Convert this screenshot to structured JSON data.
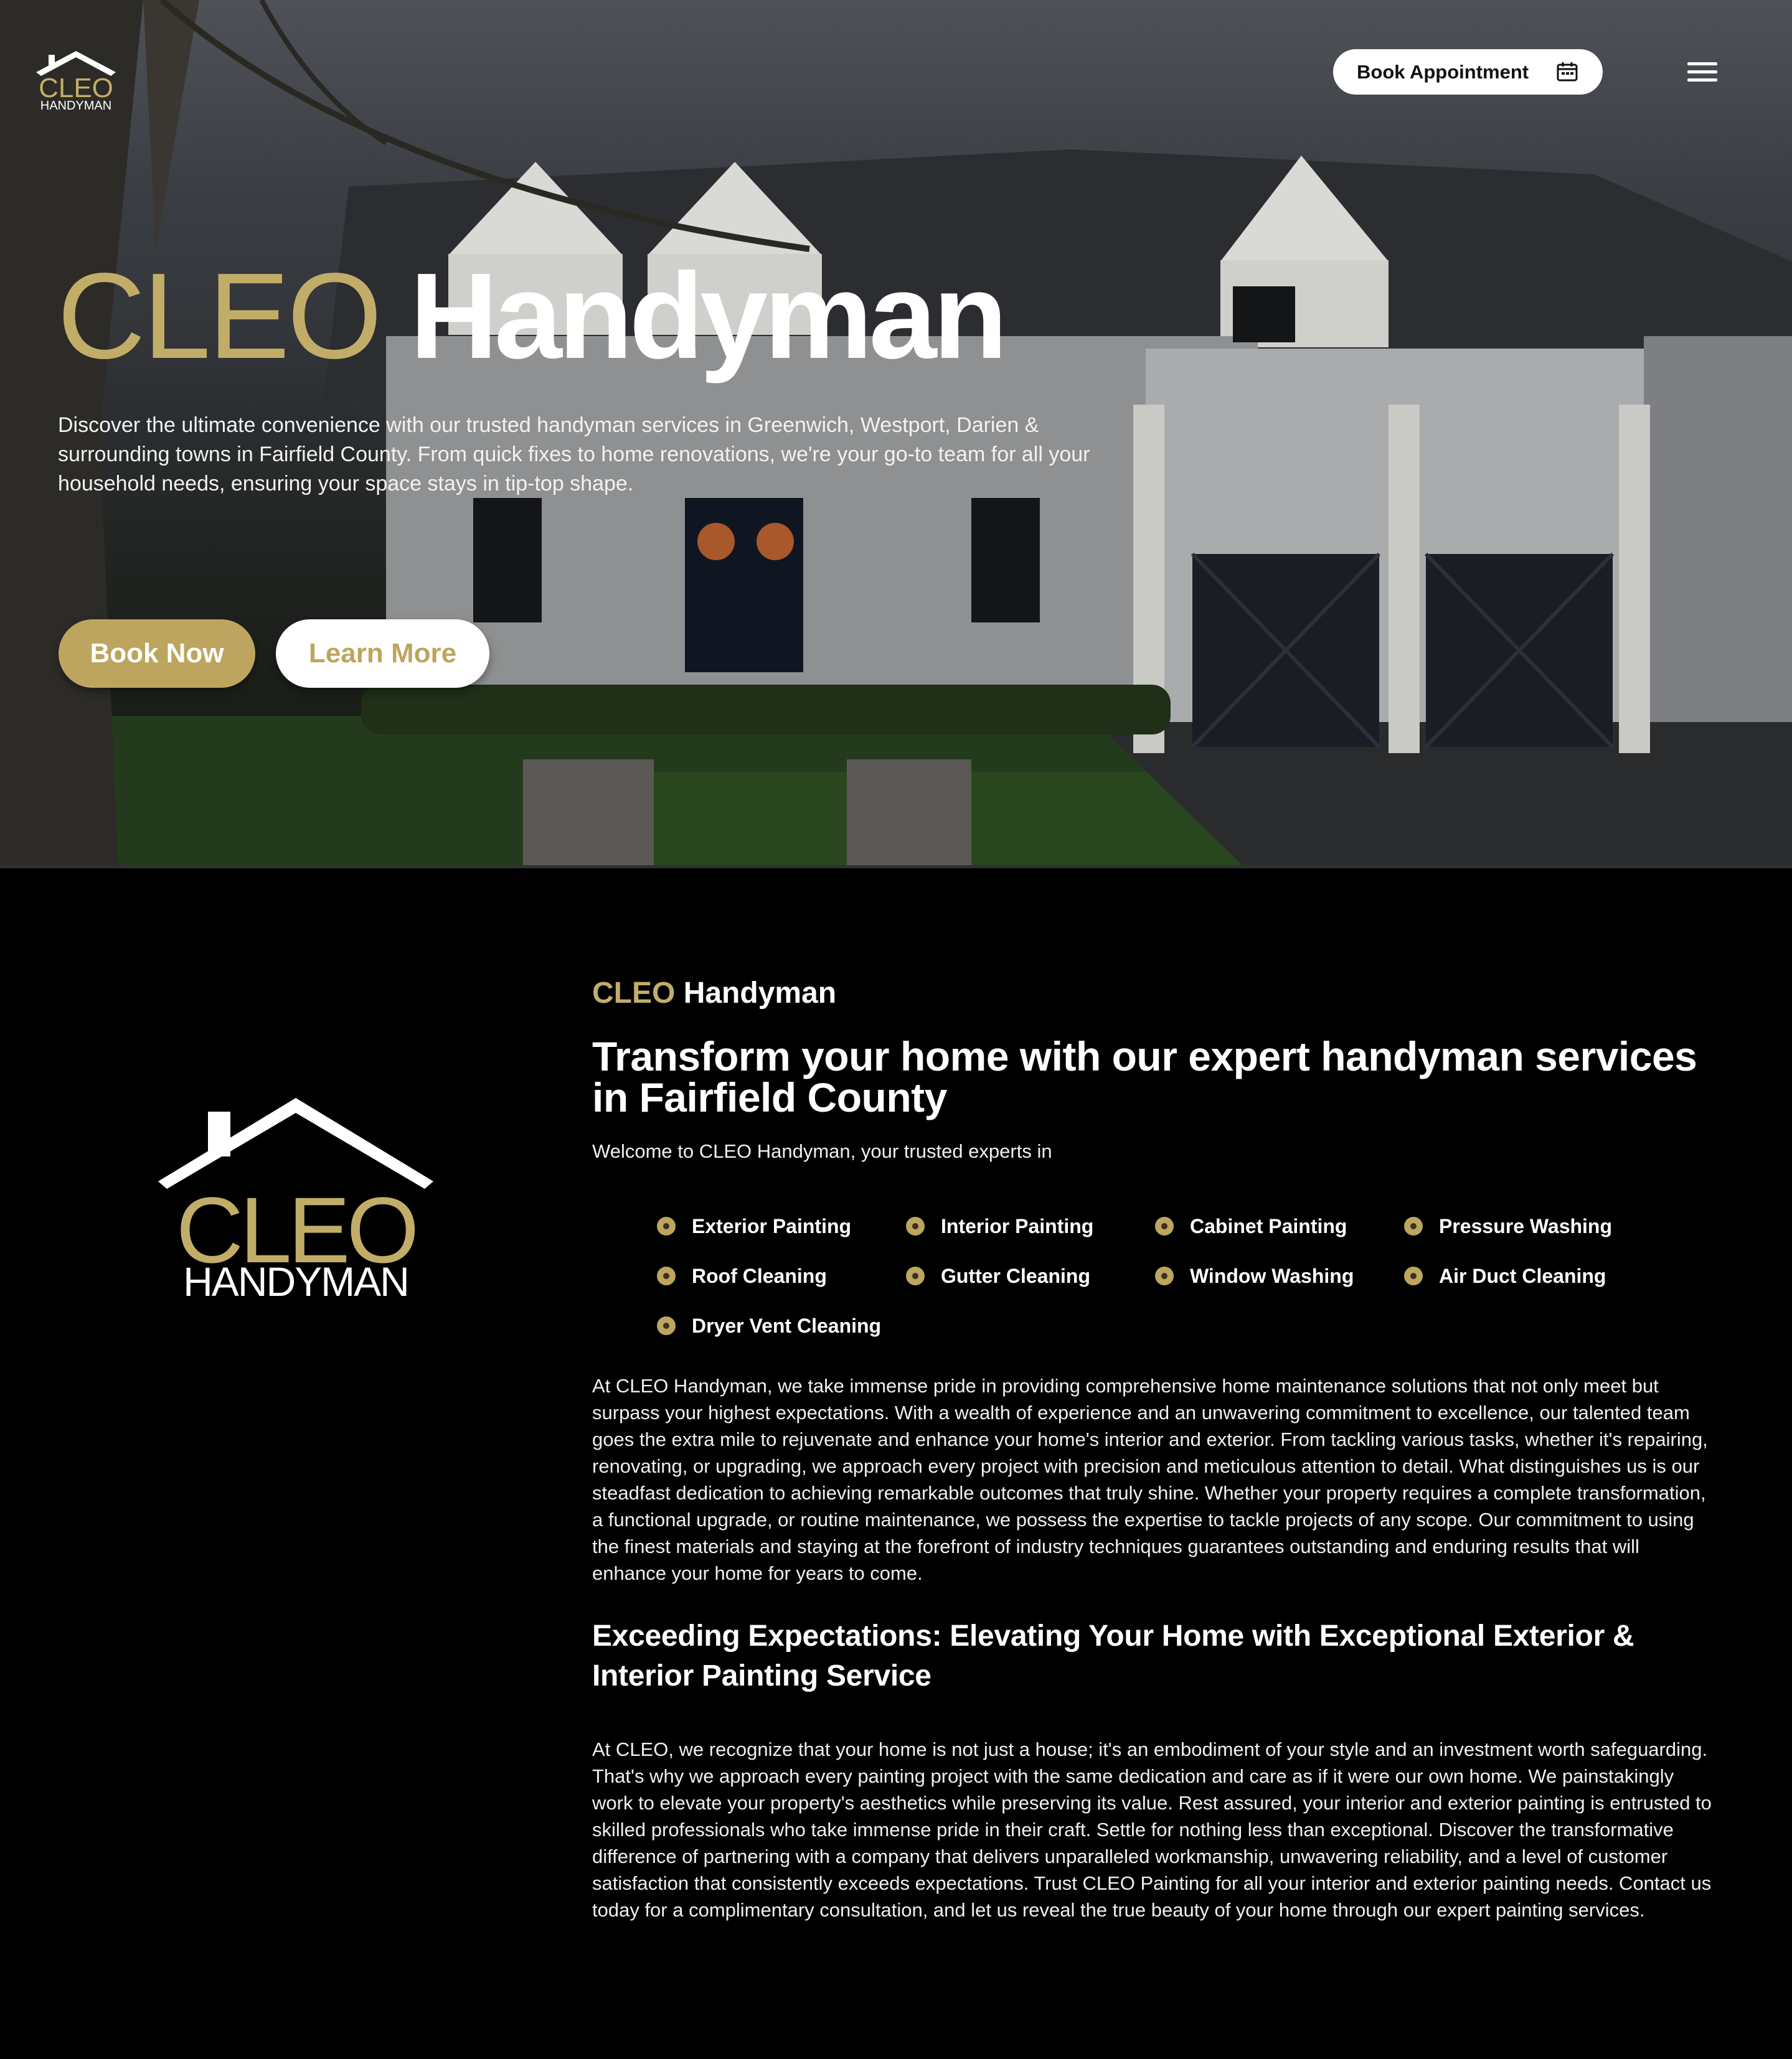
{
  "header": {
    "logo": {
      "primary": "CLEO",
      "secondary": "HANDYMAN"
    },
    "book_appointment_label": "Book Appointment",
    "icons": {
      "calendar": "calendar-icon",
      "menu": "hamburger-menu-icon"
    }
  },
  "hero": {
    "title_gold": "CLEO",
    "title_white": "Handyman",
    "description": "Discover the ultimate convenience with our trusted handyman services in Greenwich, Westport, Darien & surrounding towns in Fairfield County. From quick fixes to home renovations, we're your go-to team for all your household needs, ensuring your space stays in tip-top shape.",
    "book_now_label": "Book Now",
    "learn_more_label": "Learn More"
  },
  "about": {
    "logo": {
      "primary": "CLEO",
      "secondary": "HANDYMAN"
    },
    "brand_gold": "CLEO",
    "brand_white": "Handyman",
    "headline": "Transform your home with our expert handyman services in Fairfield County",
    "welcome": "Welcome to CLEO Handyman, your trusted experts in",
    "services": [
      "Exterior Painting",
      "Interior Painting",
      "Cabinet Painting",
      "Pressure Washing",
      "Roof Cleaning",
      "Gutter Cleaning",
      "Window Washing",
      "Air Duct Cleaning",
      "Dryer Vent Cleaning"
    ],
    "paragraph1": "At CLEO Handyman, we take immense pride in providing comprehensive home maintenance solutions that not only meet but surpass your highest expectations. With a wealth of experience and an unwavering commitment to excellence, our talented team goes the extra mile to rejuvenate and enhance your home's interior and exterior. From tackling various tasks, whether it's repairing, renovating, or upgrading, we approach every project with precision and meticulous attention to detail. What distinguishes us is our steadfast dedication to achieving remarkable outcomes that truly shine. Whether your property requires a complete transformation, a functional upgrade, or routine maintenance, we possess the expertise to tackle projects of any scope. Our commitment to using the finest materials and staying at the forefront of industry techniques guarantees outstanding and enduring results that will enhance your home for years to come.",
    "subheading": "Exceeding Expectations: Elevating Your Home with Exceptional Exterior & Interior Painting Service",
    "paragraph2": "At CLEO, we recognize that your home is not just a house; it's an embodiment of your style and an investment worth safeguarding. That's why we approach every painting project with the same dedication and care as if it were our own home. We painstakingly work to elevate your property's aesthetics while preserving its value. Rest assured, your interior and exterior painting is entrusted to skilled professionals who take immense pride in their craft. Settle for nothing less than exceptional. Discover the transformative difference of partnering with a company that delivers unparalleled workmanship, unwavering reliability, and a level of customer satisfaction that consistently exceeds expectations. Trust CLEO Painting for all your interior and exterior painting needs. Contact us today for a complimentary consultation, and let us reveal the true beauty of your home through our expert painting services."
  },
  "colors": {
    "gold": "#c2ad68",
    "button_gold": "#bda55f",
    "background": "#000000",
    "text": "#ffffff"
  }
}
